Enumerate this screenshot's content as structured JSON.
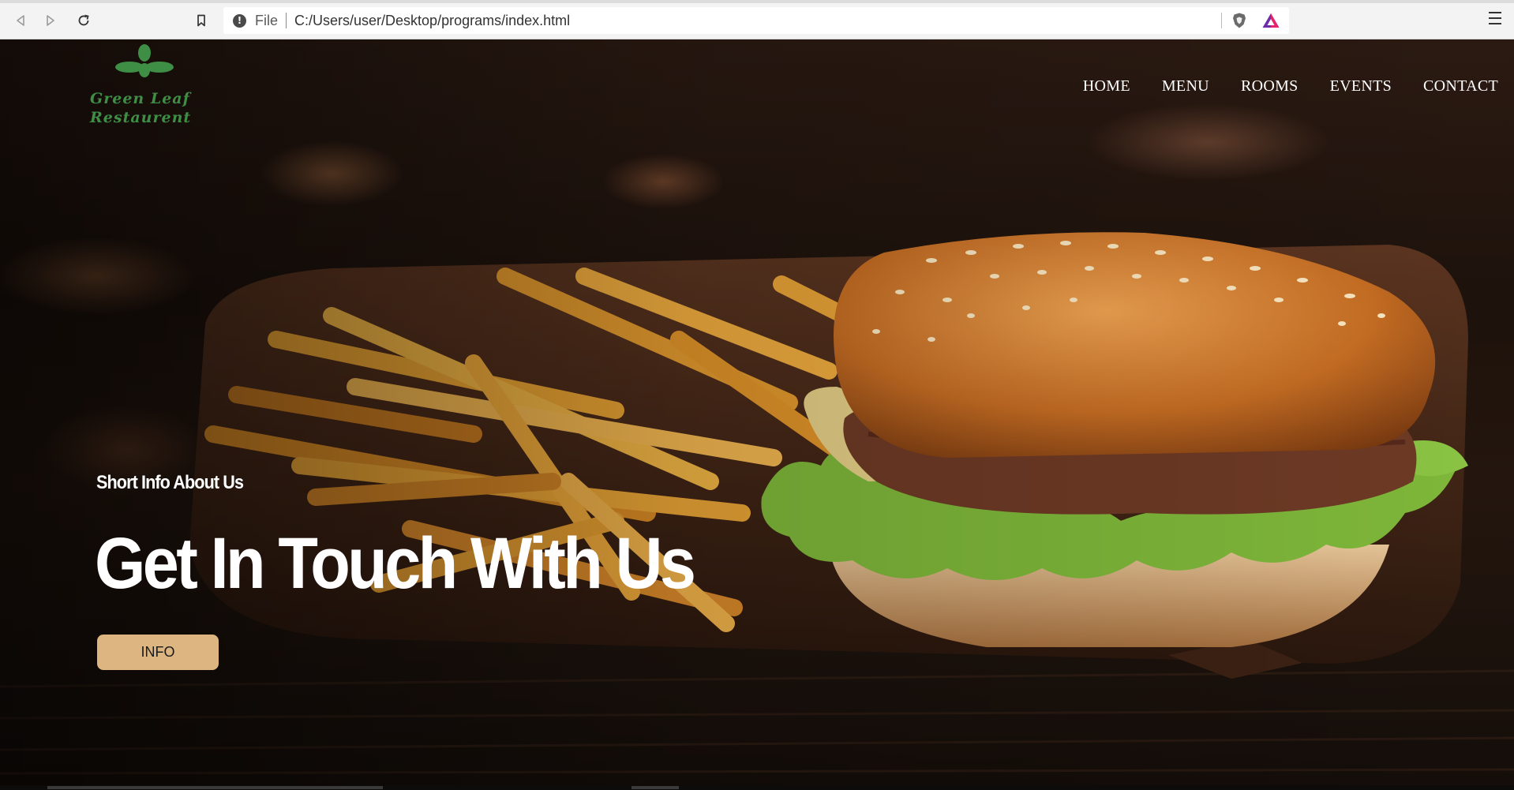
{
  "browser": {
    "scheme_label": "File",
    "url": "C:/Users/user/Desktop/programs/index.html"
  },
  "site": {
    "logo": {
      "line1": "Green Leaf",
      "line2": "Restaurent"
    },
    "nav": {
      "items": [
        {
          "label": "HOME"
        },
        {
          "label": "MENU"
        },
        {
          "label": "ROOMS"
        },
        {
          "label": "EVENTS"
        },
        {
          "label": "CONTACT"
        }
      ]
    },
    "hero": {
      "tagline": "Short Info About Us",
      "headline": "Get In Touch With Us",
      "button_label": "INFO"
    }
  },
  "colors": {
    "logo_green": "#3f8e45",
    "button_bg": "#dcb581",
    "nav_text": "#ffffff"
  },
  "icons": {
    "back": "back-arrow-icon",
    "forward": "forward-arrow-icon",
    "reload": "reload-icon",
    "bookmark": "bookmark-icon",
    "info": "info-icon",
    "brave": "brave-shield-icon",
    "rewards": "brave-rewards-icon",
    "menu": "hamburger-menu-icon"
  }
}
